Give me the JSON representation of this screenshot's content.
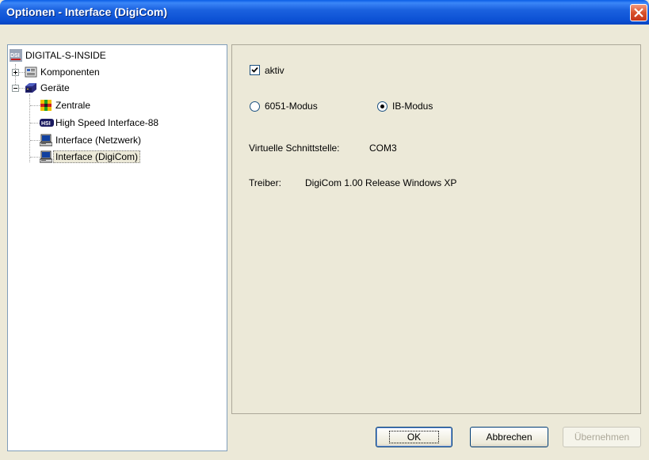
{
  "window": {
    "title": "Optionen - Interface (DigiCom)"
  },
  "tree": {
    "root": {
      "label": "DIGITAL-S-INSIDE",
      "icon": "dsi-logo-icon"
    },
    "items": [
      {
        "label": "Komponenten",
        "icon": "components-icon",
        "expander": "plus"
      },
      {
        "label": "Geräte",
        "icon": "devices-icon",
        "expander": "minus"
      },
      {
        "label": "Zentrale",
        "icon": "central-unit-icon"
      },
      {
        "label": "High Speed Interface-88",
        "icon": "hsi-icon"
      },
      {
        "label": "Interface (Netzwerk)",
        "icon": "computer-icon"
      },
      {
        "label": "Interface (DigiCom)",
        "icon": "computer-icon",
        "selected": true
      }
    ]
  },
  "panel": {
    "aktiv_label": "aktiv",
    "aktiv_checked": true,
    "mode_options": [
      "6051-Modus",
      "IB-Modus"
    ],
    "mode_selected": "IB-Modus",
    "port_label": "Virtuelle Schnittstelle:",
    "port_value": "COM3",
    "driver_label": "Treiber:",
    "driver_value": "DigiCom 1.00 Release Windows XP"
  },
  "buttons": {
    "ok": "OK",
    "cancel": "Abbrechen",
    "apply": "Übernehmen"
  }
}
